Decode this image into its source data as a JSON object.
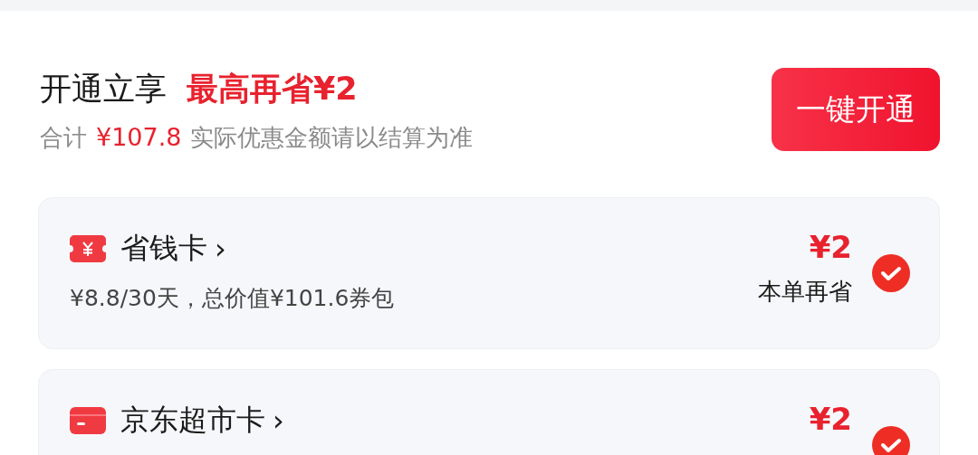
{
  "header": {
    "title": "开通立享",
    "highlight": "最高再省¥2",
    "total_label": "合计",
    "total": "¥107.8",
    "note": "实际优惠金额请以结算为准"
  },
  "open_button": "一键开通",
  "cards": [
    {
      "kind": "coupon",
      "name": "省钱卡",
      "chevron": "›",
      "desc": "¥8.8/30天，总价值¥101.6券包",
      "price": "¥2",
      "price_note": "本单再省",
      "selected": true
    },
    {
      "kind": "card",
      "name": "京东超市卡",
      "chevron": "›",
      "price": "¥2",
      "selected": true
    }
  ]
}
